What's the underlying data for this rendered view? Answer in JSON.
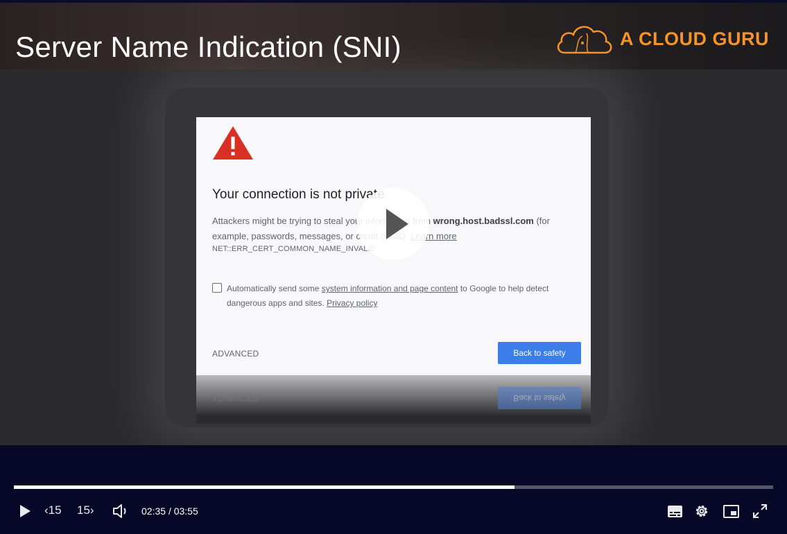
{
  "slide": {
    "title": "Server Name Indication (SNI)",
    "brand": "A CLOUD GURU",
    "brand_color": "#f5922a"
  },
  "browser_warning": {
    "heading": "Your connection is not private",
    "body_prefix": "Attackers might be trying to steal your information from ",
    "host": "wrong.host.badssl.com",
    "body_suffix": " (for example, passwords, messages, or credit cards).",
    "learn_more": "Learn more",
    "error_code": "NET::ERR_CERT_COMMON_NAME_INVALID",
    "consent_prefix": "Automatically send some ",
    "consent_link": "system information and page content",
    "consent_middle": " to Google to help detect dangerous apps and sites.",
    "privacy_link": "Privacy policy",
    "advanced_label": "ADVANCED",
    "back_button": "Back to safety",
    "button_color": "#3b7de9",
    "warning_icon_color": "#d93025"
  },
  "player": {
    "current_time": "02:35",
    "separator": "/",
    "duration": "03:55",
    "progress": 0.6596,
    "rewind_label": "15",
    "forward_label": "15",
    "icons": [
      "play-icon",
      "rewind-15-icon",
      "forward-15-icon",
      "volume-icon",
      "captions-icon",
      "settings-icon",
      "picture-in-picture-icon",
      "fullscreen-icon"
    ],
    "background_color": "#070727"
  }
}
